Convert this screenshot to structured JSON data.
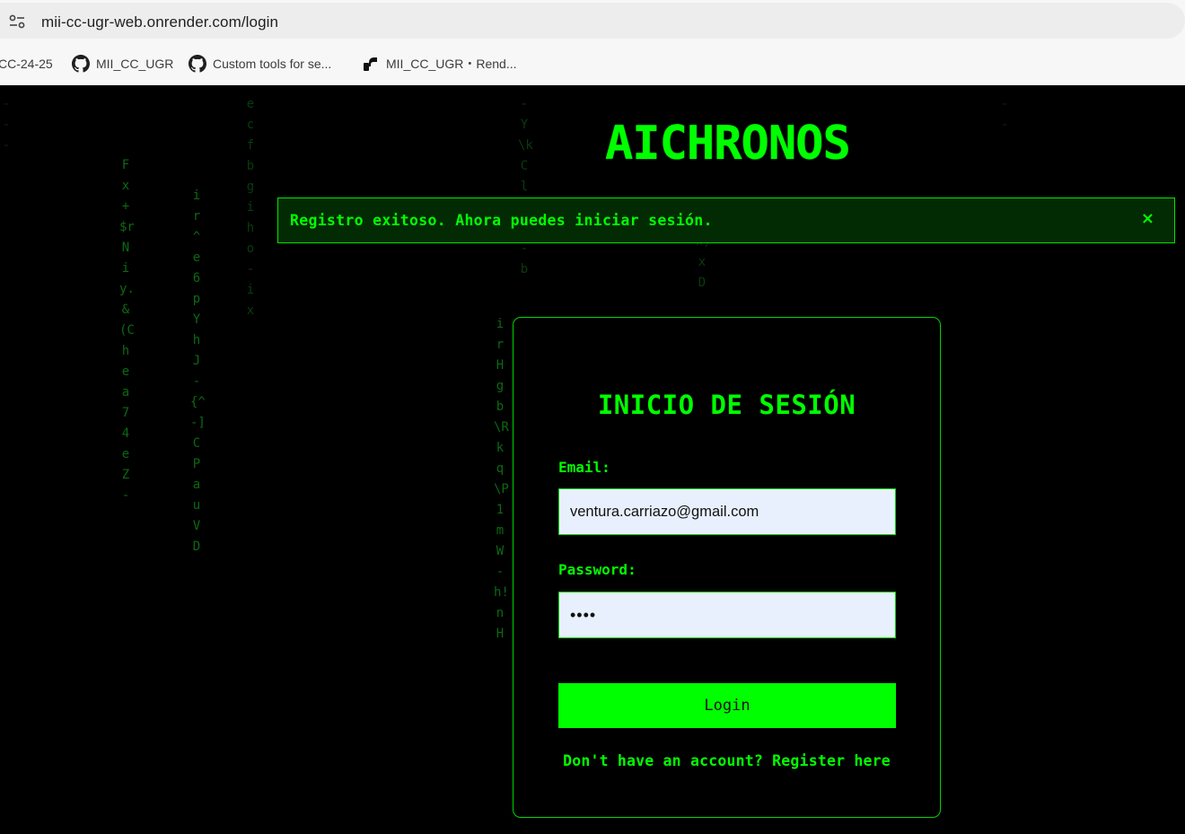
{
  "browser": {
    "url": "mii-cc-ugr-web.onrender.com/login",
    "bookmarks": [
      {
        "label": "CC-24-25",
        "icon": "none"
      },
      {
        "label": "MII_CC_UGR",
        "icon": "github-icon"
      },
      {
        "label": "Custom tools for se...",
        "icon": "github-icon"
      },
      {
        "label": "MII_CC_UGR・Rend...",
        "icon": "render-icon"
      }
    ]
  },
  "page": {
    "brand": "AICHRONOS",
    "alert": {
      "message": "Registro exitoso. Ahora puedes iniciar sesión.",
      "close": "×"
    },
    "form": {
      "title": "INICIO DE SESIÓN",
      "email_label": "Email:",
      "email_value": "ventura.carriazo@gmail.com",
      "password_label": "Password:",
      "password_value": "••••",
      "login_label": "Login",
      "register_text": "Don't have an account? Register here"
    },
    "rain": [
      "Fx+$rNiy.&(Chea74eZ-",
      "ir^e6pYhJ-{^-]CPauVD",
      "ecfbgiho-ix",
      "irHgb\\Rkq\\P1mW-h!nH",
      "-Y\\kCl1w-b",
      "dx)xD",
      "---",
      "--"
    ],
    "colors": {
      "accent": "#00ff00",
      "background": "#000000",
      "alert_bg": "#032b03",
      "input_bg": "#e8f0fe"
    }
  }
}
